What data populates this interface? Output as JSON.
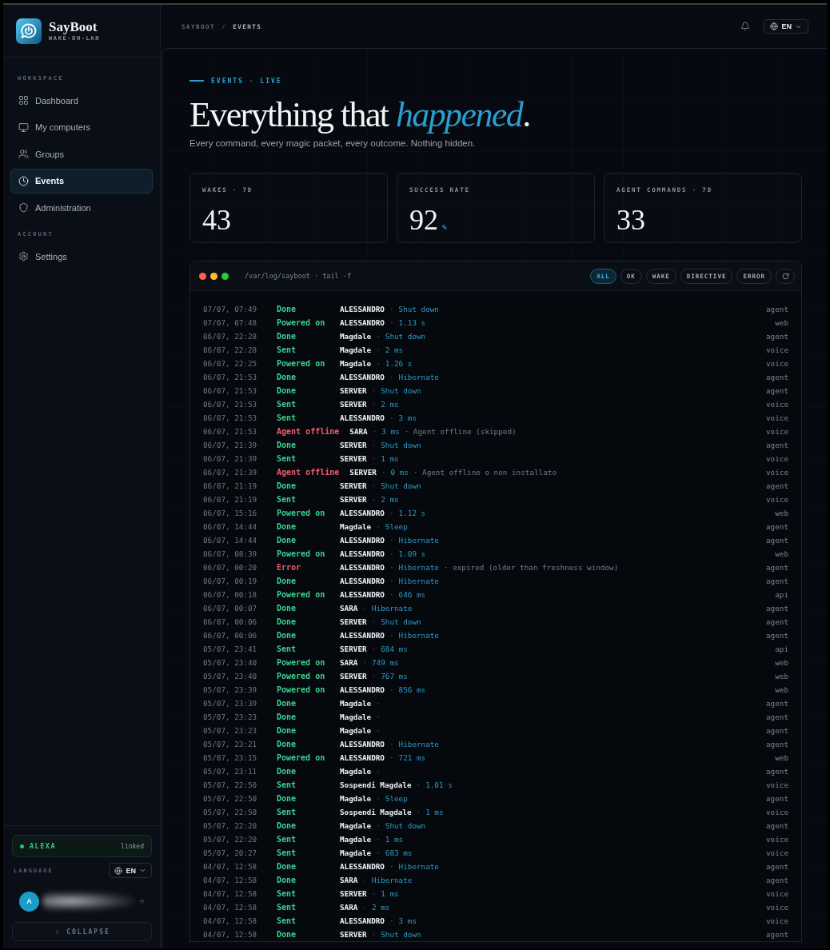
{
  "sidebar": {
    "brand": {
      "name": "SayBoot",
      "tagline": "WAKE-ON-LAN"
    },
    "sections": [
      {
        "title": "WORKSPACE",
        "items": [
          {
            "label": "Dashboard",
            "selected": false
          },
          {
            "label": "My computers",
            "selected": false
          },
          {
            "label": "Groups",
            "selected": false
          },
          {
            "label": "Events",
            "selected": true
          },
          {
            "label": "Administration",
            "selected": false
          }
        ]
      },
      {
        "title": "ACCOUNT",
        "items": [
          {
            "label": "Settings",
            "selected": false
          }
        ]
      }
    ],
    "integration": {
      "name": "ALEXA",
      "status": "linked"
    },
    "language": {
      "label": "LANGUAGE",
      "value": "EN"
    },
    "user": {
      "initial": "A"
    },
    "collapse": {
      "label": "COLLAPSE"
    }
  },
  "header": {
    "breadcrumb": {
      "items": [
        "SAYBOOT",
        "EVENTS"
      ],
      "separator": "/"
    },
    "language": {
      "value": "EN"
    }
  },
  "hero": {
    "eyebrow": "EVENTS · LIVE",
    "title": "Everything that *happened*.",
    "subtitle": "Every command, every magic packet, every outcome. Nothing hidden."
  },
  "stats": [
    {
      "label": "WAKES · 7D",
      "value": "43"
    },
    {
      "label": "SUCCESS RATE",
      "value": "92",
      "unit": "%"
    },
    {
      "label": "AGENT COMMANDS · 7D",
      "value": "33"
    }
  ],
  "log": {
    "path": "/var/log/sayboot · tail -f",
    "filters": [
      {
        "label": "ALL",
        "selected": true
      },
      {
        "label": "OK",
        "selected": false
      },
      {
        "label": "WAKE",
        "selected": false
      },
      {
        "label": "DIRECTIVE",
        "selected": false
      },
      {
        "label": "ERROR",
        "selected": false
      }
    ],
    "rows": [
      {
        "time": "07/07, 07:49",
        "status": "Done",
        "color": "#3ccf8e",
        "device": "ALESSANDRO",
        "separator": "·",
        "detail": "Shut down",
        "source": "agent"
      },
      {
        "time": "07/07, 07:48",
        "status": "Powered on",
        "color": "#3ccf8e",
        "device": "ALESSANDRO",
        "separator": "·",
        "detail": "1.13 s",
        "source": "web"
      },
      {
        "time": "06/07, 22:28",
        "status": "Done",
        "color": "#3ccf8e",
        "device": "Magdale",
        "separator": "·",
        "detail": "Shut down",
        "source": "agent"
      },
      {
        "time": "06/07, 22:28",
        "status": "Sent",
        "color": "#3ccf8e",
        "device": "Magdale",
        "separator": "·",
        "detail": "2 ms",
        "source": "voice"
      },
      {
        "time": "06/07, 22:25",
        "status": "Powered on",
        "color": "#3ccf8e",
        "device": "Magdale",
        "separator": "·",
        "detail": "1.26 s",
        "source": "voice"
      },
      {
        "time": "06/07, 21:53",
        "status": "Done",
        "color": "#3ccf8e",
        "device": "ALESSANDRO",
        "separator": "·",
        "detail": "Hibernate",
        "source": "agent"
      },
      {
        "time": "06/07, 21:53",
        "status": "Done",
        "color": "#3ccf8e",
        "device": "SERVER",
        "separator": "·",
        "detail": "Shut down",
        "source": "agent"
      },
      {
        "time": "06/07, 21:53",
        "status": "Sent",
        "color": "#3ccf8e",
        "device": "SERVER",
        "separator": "·",
        "detail": "2 ms",
        "source": "voice"
      },
      {
        "time": "06/07, 21:53",
        "status": "Sent",
        "color": "#3ccf8e",
        "device": "ALESSANDRO",
        "separator": "·",
        "detail": "3 ms",
        "source": "voice"
      },
      {
        "time": "06/07, 21:53",
        "status": "Agent offline",
        "color": "#ee5d6c",
        "device": "SARA",
        "separator": "·",
        "detail": "3 ms",
        "note": "· Agent offline (skipped)",
        "source": "voice"
      },
      {
        "time": "06/07, 21:39",
        "status": "Done",
        "color": "#3ccf8e",
        "device": "SERVER",
        "separator": "·",
        "detail": "Shut down",
        "source": "agent"
      },
      {
        "time": "06/07, 21:39",
        "status": "Sent",
        "color": "#3ccf8e",
        "device": "SERVER",
        "separator": "·",
        "detail": "1 ms",
        "source": "voice"
      },
      {
        "time": "06/07, 21:39",
        "status": "Agent offline",
        "color": "#ee5d6c",
        "device": "SERVER",
        "separator": "·",
        "detail": "0 ms",
        "note": "· Agent offline o non installato",
        "source": "voice"
      },
      {
        "time": "06/07, 21:19",
        "status": "Done",
        "color": "#3ccf8e",
        "device": "SERVER",
        "separator": "·",
        "detail": "Shut down",
        "source": "agent"
      },
      {
        "time": "06/07, 21:19",
        "status": "Sent",
        "color": "#3ccf8e",
        "device": "SERVER",
        "separator": "·",
        "detail": "2 ms",
        "source": "voice"
      },
      {
        "time": "06/07, 15:16",
        "status": "Powered on",
        "color": "#3ccf8e",
        "device": "ALESSANDRO",
        "separator": "·",
        "detail": "1.12 s",
        "source": "web"
      },
      {
        "time": "06/07, 14:44",
        "status": "Done",
        "color": "#3ccf8e",
        "device": "Magdale",
        "separator": "·",
        "detail": "Sleep",
        "source": "agent"
      },
      {
        "time": "06/07, 14:44",
        "status": "Done",
        "color": "#3ccf8e",
        "device": "ALESSANDRO",
        "separator": "·",
        "detail": "Hibernate",
        "source": "agent"
      },
      {
        "time": "06/07, 08:39",
        "status": "Powered on",
        "color": "#3ccf8e",
        "device": "ALESSANDRO",
        "separator": "·",
        "detail": "1.09 s",
        "source": "web"
      },
      {
        "time": "06/07, 00:20",
        "status": "Error",
        "color": "#ee5d6c",
        "device": "ALESSANDRO",
        "separator": "·",
        "detail": "Hibernate",
        "note": "· expired (older than freshness window)",
        "source": "agent"
      },
      {
        "time": "06/07, 00:19",
        "status": "Done",
        "color": "#3ccf8e",
        "device": "ALESSANDRO",
        "separator": "·",
        "detail": "Hibernate",
        "source": "agent"
      },
      {
        "time": "06/07, 00:18",
        "status": "Powered on",
        "color": "#3ccf8e",
        "device": "ALESSANDRO",
        "separator": "·",
        "detail": "646 ms",
        "source": "api"
      },
      {
        "time": "06/07, 00:07",
        "status": "Done",
        "color": "#3ccf8e",
        "device": "SARA",
        "separator": "·",
        "detail": "Hibernate",
        "source": "agent"
      },
      {
        "time": "06/07, 00:06",
        "status": "Done",
        "color": "#3ccf8e",
        "device": "SERVER",
        "separator": "·",
        "detail": "Shut down",
        "source": "agent"
      },
      {
        "time": "06/07, 00:06",
        "status": "Done",
        "color": "#3ccf8e",
        "device": "ALESSANDRO",
        "separator": "·",
        "detail": "Hibernate",
        "source": "agent"
      },
      {
        "time": "05/07, 23:41",
        "status": "Sent",
        "color": "#3ccf8e",
        "device": "SERVER",
        "separator": "·",
        "detail": "684 ms",
        "source": "api"
      },
      {
        "time": "05/07, 23:40",
        "status": "Powered on",
        "color": "#3ccf8e",
        "device": "SARA",
        "separator": "·",
        "detail": "749 ms",
        "source": "web"
      },
      {
        "time": "05/07, 23:40",
        "status": "Powered on",
        "color": "#3ccf8e",
        "device": "SERVER",
        "separator": "·",
        "detail": "767 ms",
        "source": "web"
      },
      {
        "time": "05/07, 23:39",
        "status": "Powered on",
        "color": "#3ccf8e",
        "device": "ALESSANDRO",
        "separator": "·",
        "detail": "856 ms",
        "source": "web"
      },
      {
        "time": "05/07, 23:39",
        "status": "Done",
        "color": "#3ccf8e",
        "device": "Magdale",
        "separator": "·",
        "source": "agent"
      },
      {
        "time": "05/07, 23:23",
        "status": "Done",
        "color": "#3ccf8e",
        "device": "Magdale",
        "separator": "·",
        "source": "agent"
      },
      {
        "time": "05/07, 23:23",
        "status": "Done",
        "color": "#3ccf8e",
        "device": "Magdale",
        "separator": "·",
        "source": "agent"
      },
      {
        "time": "05/07, 23:21",
        "status": "Done",
        "color": "#3ccf8e",
        "device": "ALESSANDRO",
        "separator": "·",
        "detail": "Hibernate",
        "source": "agent"
      },
      {
        "time": "05/07, 23:15",
        "status": "Powered on",
        "color": "#3ccf8e",
        "device": "ALESSANDRO",
        "separator": "·",
        "detail": "721 ms",
        "source": "web"
      },
      {
        "time": "05/07, 23:11",
        "status": "Done",
        "color": "#3ccf8e",
        "device": "Magdale",
        "separator": "·",
        "source": "agent"
      },
      {
        "time": "05/07, 22:50",
        "status": "Sent",
        "color": "#3ccf8e",
        "device": "Sospendi Magdale",
        "separator": "·",
        "detail": "1.01 s",
        "source": "voice"
      },
      {
        "time": "05/07, 22:50",
        "status": "Done",
        "color": "#3ccf8e",
        "device": "Magdale",
        "separator": "·",
        "detail": "Sleep",
        "source": "agent"
      },
      {
        "time": "05/07, 22:50",
        "status": "Sent",
        "color": "#3ccf8e",
        "device": "Sospendi Magdale",
        "separator": "·",
        "detail": "1 ms",
        "source": "voice"
      },
      {
        "time": "05/07, 22:20",
        "status": "Done",
        "color": "#3ccf8e",
        "device": "Magdale",
        "separator": "·",
        "detail": "Shut down",
        "source": "agent"
      },
      {
        "time": "05/07, 22:20",
        "status": "Sent",
        "color": "#3ccf8e",
        "device": "Magdale",
        "separator": "·",
        "detail": "1 ms",
        "source": "voice"
      },
      {
        "time": "05/07, 20:27",
        "status": "Sent",
        "color": "#3ccf8e",
        "device": "Magdale",
        "separator": "·",
        "detail": "683 ms",
        "source": "voice"
      },
      {
        "time": "04/07, 12:58",
        "status": "Done",
        "color": "#3ccf8e",
        "device": "ALESSANDRO",
        "separator": "·",
        "detail": "Hibernate",
        "source": "agent"
      },
      {
        "time": "04/07, 12:58",
        "status": "Done",
        "color": "#3ccf8e",
        "device": "SARA",
        "separator": "·",
        "detail": "Hibernate",
        "source": "agent"
      },
      {
        "time": "04/07, 12:58",
        "status": "Sent",
        "color": "#3ccf8e",
        "device": "SERVER",
        "separator": "·",
        "detail": "1 ms",
        "source": "voice"
      },
      {
        "time": "04/07, 12:58",
        "status": "Sent",
        "color": "#3ccf8e",
        "device": "SARA",
        "separator": "·",
        "detail": "2 ms",
        "source": "voice"
      },
      {
        "time": "04/07, 12:58",
        "status": "Sent",
        "color": "#3ccf8e",
        "device": "ALESSANDRO",
        "separator": "·",
        "detail": "3 ms",
        "source": "voice"
      },
      {
        "time": "04/07, 12:58",
        "status": "Done",
        "color": "#3ccf8e",
        "device": "SERVER",
        "separator": "·",
        "detail": "Shut down",
        "source": "agent"
      }
    ]
  }
}
